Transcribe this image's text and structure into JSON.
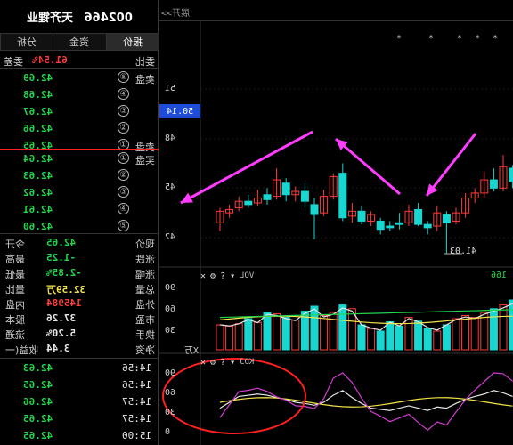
{
  "stock": {
    "code": "002466",
    "name": "天齐锂业"
  },
  "tabs": [
    {
      "label": "报价",
      "active": true
    },
    {
      "label": "资金",
      "active": false
    },
    {
      "label": "分析",
      "active": false
    }
  ],
  "weibi": {
    "label": "委比",
    "value": "61.54%",
    "extra": "委差"
  },
  "sell_orders": [
    {
      "label": "卖盘",
      "index": "⑤",
      "price": "42.69"
    },
    {
      "label": "",
      "index": "④",
      "price": "42.68"
    },
    {
      "label": "",
      "index": "③",
      "price": "42.67"
    },
    {
      "label": "",
      "index": "②",
      "price": "42.66"
    },
    {
      "label": "卖盘",
      "index": "①",
      "price": "42.65"
    }
  ],
  "buy_orders": [
    {
      "label": "买盘",
      "index": "①",
      "price": "42.64"
    },
    {
      "label": "",
      "index": "②",
      "price": "42.63"
    },
    {
      "label": "",
      "index": "③",
      "price": "42.62"
    },
    {
      "label": "",
      "index": "④",
      "price": "42.61"
    },
    {
      "label": "",
      "index": "⑤",
      "price": "42.60"
    }
  ],
  "stats": [
    {
      "label": "现价",
      "value": "42.65",
      "label2": "今开",
      "value2": ""
    },
    {
      "label": "涨跌",
      "value": "-1.25",
      "label2": "最高",
      "value2": ""
    },
    {
      "label": "涨幅",
      "value": "-2.85%",
      "label2": "最低",
      "value2": ""
    },
    {
      "label": "总量",
      "value": "32.59万",
      "label2": "量比",
      "value2": ""
    },
    {
      "label": "外盘",
      "value": "145984",
      "label2": "内盘",
      "value2": ""
    },
    {
      "label": "市盈",
      "value": "37.26",
      "label2": "股本",
      "value2": ""
    },
    {
      "label": "换手",
      "value": "5.20%",
      "label2": "流通",
      "value2": ""
    },
    {
      "label": "净资",
      "value": "3.44",
      "label2": "收益(一",
      "value2": ""
    }
  ],
  "ticks": [
    {
      "time": "14:56",
      "price": "42.63"
    },
    {
      "time": "14:56",
      "price": "42.65"
    },
    {
      "time": "14:57",
      "price": "42.66"
    },
    {
      "time": "14:57",
      "price": "42.65"
    },
    {
      "time": "15:00",
      "price": "42.65"
    }
  ],
  "right_panel": {
    "toggle": "展开>>",
    "price_axis": [
      "51",
      "48",
      "45",
      "42"
    ],
    "current_price": "50.14",
    "low_label": "41.03",
    "vol_label": "VOL",
    "vol_axis": [
      "90",
      "60",
      "30"
    ],
    "vol_unit": "X万",
    "vol_value": "166",
    "kdj_label": "KDJ",
    "kdj_axis": [
      "90",
      "60",
      "30",
      "0"
    ],
    "stars": [
      "*",
      "*",
      "* * *"
    ]
  },
  "colors": {
    "up": "#ff3b3b",
    "down": "#18d7d0",
    "arrow": "#ff3cff",
    "circle": "#ff2020",
    "price_green": "#21d64a"
  }
}
